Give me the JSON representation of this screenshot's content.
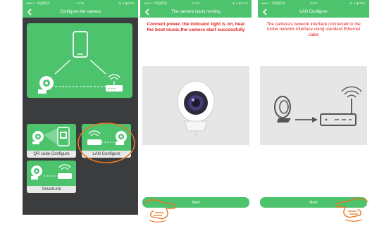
{
  "phone1": {
    "status": {
      "carrier": "●●●○○ 中国移动 ",
      "time": "11:02",
      "battery": "⊕ ✈ ▮ 62%"
    },
    "title": "Configure the camera",
    "options": {
      "qr": "QR code Configure",
      "lan": "LAN Configure",
      "smartlink": "SmartLink"
    }
  },
  "phone2": {
    "status": {
      "carrier": "●●●○○ 中国移动 ",
      "time": "11:03",
      "battery": "⊕ ✈ ▮ 61%"
    },
    "title": "The camera starts running",
    "message": "Connect power, the indicator light is on, hear the boot music,the camera start successfully",
    "next": "Next"
  },
  "phone3": {
    "status": {
      "carrier": "●●●○○ 中国移动 ",
      "time": "10:07",
      "battery": "⊕ ✈ ▮ 35%"
    },
    "title": "LAN Configure",
    "message": "The camera's network interface connected to the router network interface using standard Ethernet cable",
    "next": "Next"
  },
  "colors": {
    "primary": "#4dc36d",
    "dark_bg": "#3a3c3e",
    "message_red": "#e02020",
    "highlight": "#e87722"
  }
}
